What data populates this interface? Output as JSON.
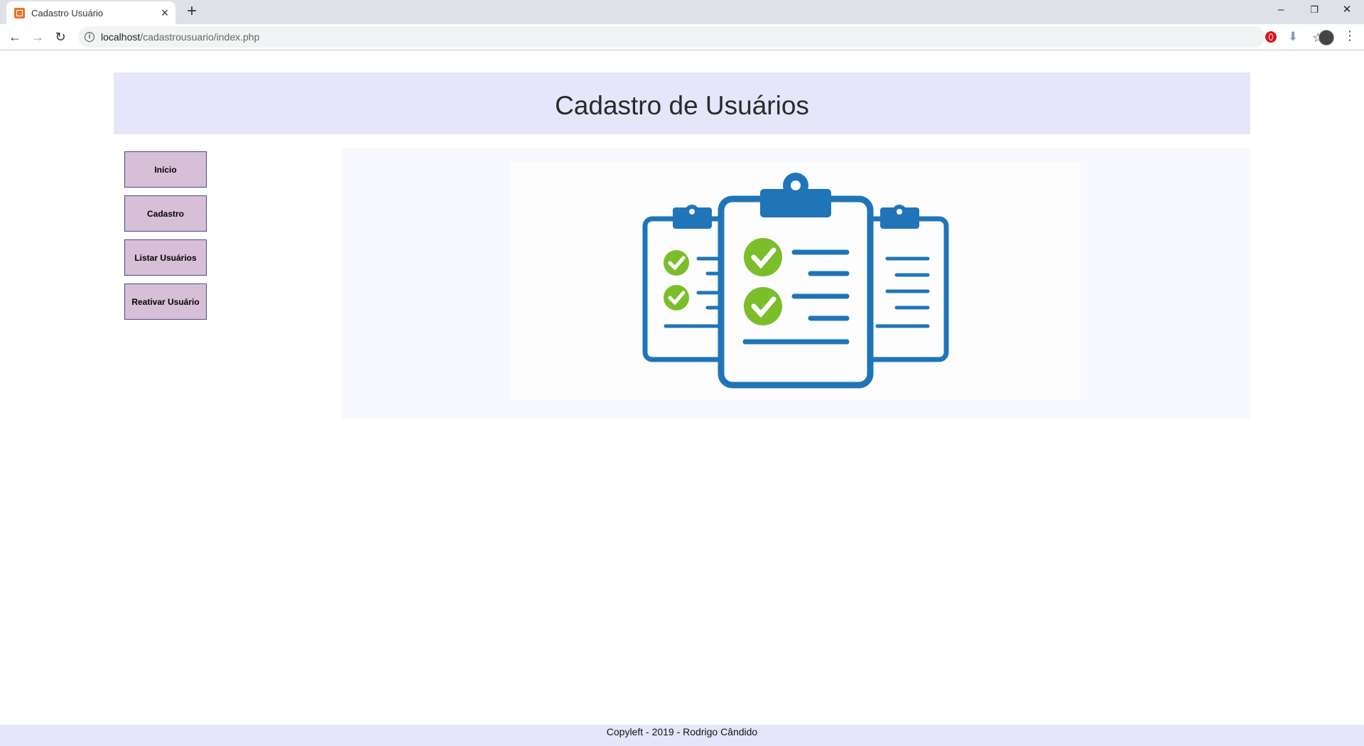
{
  "browser": {
    "tab_title": "Cadastro Usuário",
    "tab_close": "×",
    "new_tab": "+",
    "url_host": "localhost",
    "url_path": "/cadastrousuario/index.php",
    "window": {
      "minimize": "–",
      "restore": "❐",
      "close": "✕"
    },
    "nav": {
      "back": "←",
      "forward": "→",
      "reload": "↻"
    },
    "star": "☆",
    "menu": "⋮"
  },
  "header": {
    "title": "Cadastro de Usuários"
  },
  "sidebar": {
    "items": [
      {
        "label": "Início"
      },
      {
        "label": "Cadastro"
      },
      {
        "label": "Listar Usuários"
      },
      {
        "label": "Reativar Usuário"
      }
    ]
  },
  "hero": {
    "image": "clipboards-checklist-illustration",
    "colors": {
      "clipboard": "#1f75b8",
      "check": "#7cbd2a"
    }
  },
  "footer": {
    "text": "Copyleft - 2019 - Rodrigo Cândido"
  }
}
